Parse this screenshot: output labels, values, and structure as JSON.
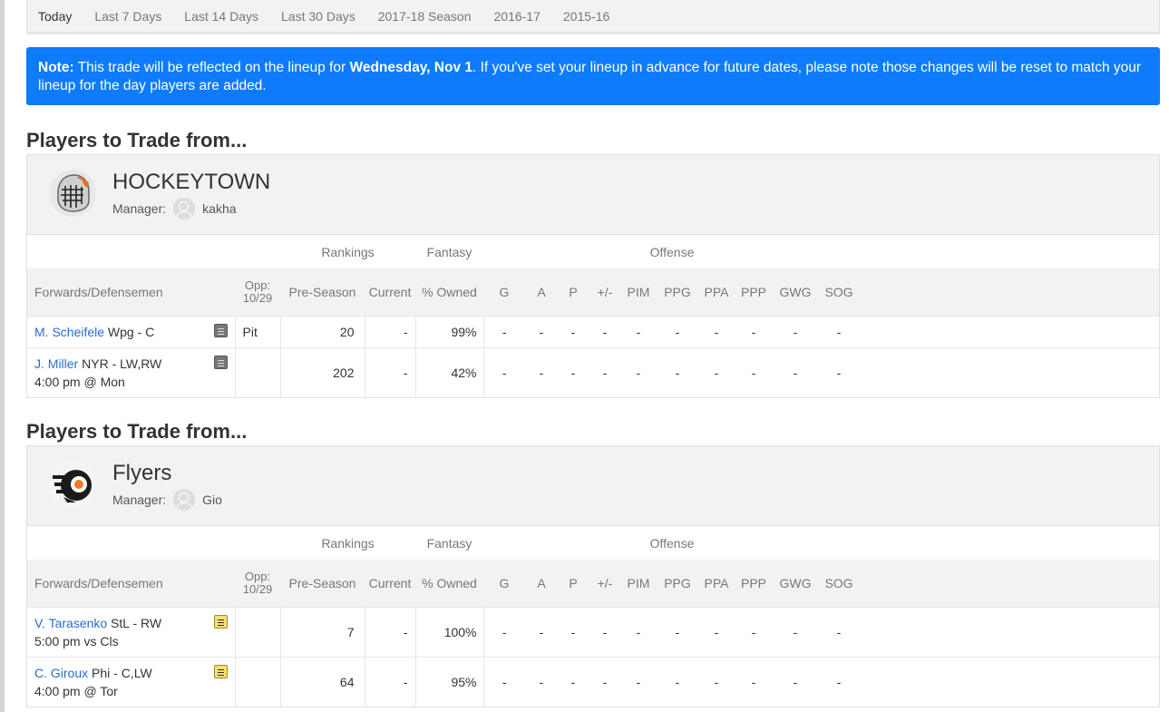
{
  "tabs": [
    "Today",
    "Last 7 Days",
    "Last 14 Days",
    "Last 30 Days",
    "2017-18 Season",
    "2016-17",
    "2015-16"
  ],
  "note": {
    "label": "Note:",
    "text1": " This trade will be reflected on the lineup for ",
    "date": "Wednesday, Nov 1",
    "text2": ". If you've set your lineup in advance for future dates, please note those changes will be reset to match your lineup for the day players are added."
  },
  "columns": {
    "group_rankings": "Rankings",
    "group_fantasy": "Fantasy",
    "group_offense": "Offense",
    "player": "Forwards/Defensemen",
    "opp_line1": "Opp:",
    "opp_line2": "10/29",
    "preseason": "Pre-Season",
    "current": "Current",
    "owned": "% Owned",
    "stats": [
      "G",
      "A",
      "P",
      "+/-",
      "PIM",
      "PPG",
      "PPA",
      "PPP",
      "GWG",
      "SOG"
    ]
  },
  "teams": [
    {
      "section_title": "Players to Trade from...",
      "name": "HOCKEYTOWN",
      "manager_label": "Manager:",
      "manager": "kakha",
      "logo_icon": "goalie-mask-icon",
      "players": [
        {
          "name": "M. Scheifele",
          "info": " Wpg - C",
          "game": "",
          "note": "gray",
          "opp": "Pit",
          "preseason": "20",
          "current": "-",
          "owned": "99%"
        },
        {
          "name": "J. Miller",
          "info": " NYR - LW,RW",
          "game": "4:00 pm @ Mon",
          "note": "gray",
          "opp": "",
          "preseason": "202",
          "current": "-",
          "owned": "42%"
        }
      ]
    },
    {
      "section_title": "Players to Trade from...",
      "name": "Flyers",
      "manager_label": "Manager:",
      "manager": "Gio",
      "logo_icon": "flyers-logo-icon",
      "players": [
        {
          "name": "V. Tarasenko",
          "info": " StL - RW",
          "game": "5:00 pm vs Cls",
          "note": "yellow",
          "opp": "",
          "preseason": "7",
          "current": "-",
          "owned": "100%"
        },
        {
          "name": "C. Giroux",
          "info": " Phi - C,LW",
          "game": "4:00 pm @ Tor",
          "note": "yellow",
          "opp": "",
          "preseason": "64",
          "current": "-",
          "owned": "95%"
        }
      ]
    }
  ],
  "stat_placeholder": "-"
}
